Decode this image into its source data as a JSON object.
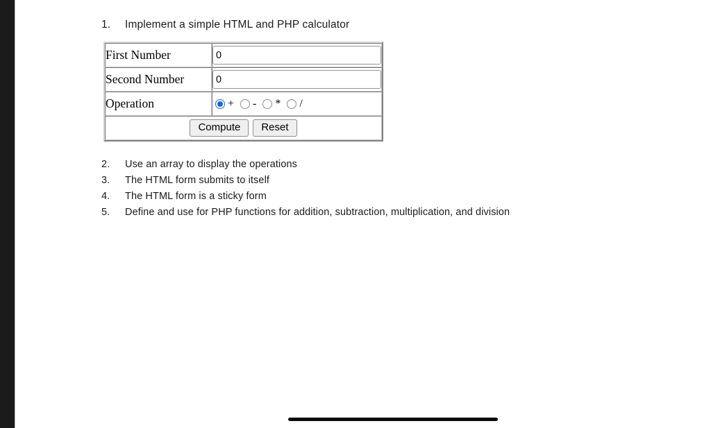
{
  "document": {
    "heading": {
      "number": "1.",
      "text": "Implement a simple HTML and PHP calculator"
    },
    "calculator": {
      "rows": [
        {
          "label": "First Number",
          "value": "0",
          "placeholder": ""
        },
        {
          "label": "Second Number",
          "value": "0",
          "placeholder": ""
        }
      ],
      "operation": {
        "label": "Operation",
        "options": [
          {
            "symbol": "+",
            "checked": true
          },
          {
            "symbol": "-",
            "checked": false
          },
          {
            "symbol": "*",
            "checked": false
          },
          {
            "symbol": "/",
            "checked": false
          }
        ]
      },
      "buttons": {
        "compute": "Compute",
        "reset": "Reset"
      }
    },
    "requirements": [
      {
        "number": "2.",
        "text": "Use an array to display the operations"
      },
      {
        "number": "3.",
        "text": "The HTML form submits to itself"
      },
      {
        "number": "4.",
        "text": "The HTML form is a sticky form"
      },
      {
        "number": "5.",
        "text": "Define and use for PHP functions for addition, subtraction, multiplication, and division"
      }
    ]
  },
  "colors": {
    "accent": "#1667d8",
    "bezel": "#1b1b1b",
    "text": "#1a1a1a",
    "home_indicator": "#0b0b0b"
  }
}
